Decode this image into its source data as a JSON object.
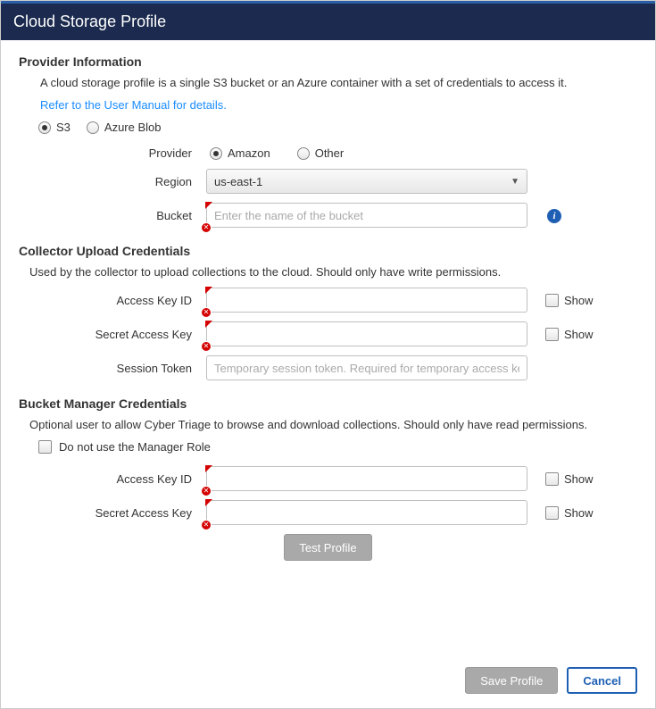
{
  "title": "Cloud Storage Profile",
  "provider_info": {
    "heading": "Provider Information",
    "description": "A cloud storage profile is a single S3 bucket or an Azure container with a set of credentials to access it.",
    "manual_link": "Refer to the User Manual for details.",
    "storage_types": {
      "s3": "S3",
      "azure": "Azure Blob"
    },
    "provider_label": "Provider",
    "providers": {
      "amazon": "Amazon",
      "other": "Other"
    },
    "region_label": "Region",
    "region_value": "us-east-1",
    "bucket_label": "Bucket",
    "bucket_placeholder": "Enter the name of the bucket"
  },
  "collector": {
    "heading": "Collector Upload Credentials",
    "description": "Used by the collector to upload collections to the cloud. Should only have write permissions.",
    "access_key_label": "Access Key ID",
    "secret_key_label": "Secret Access Key",
    "session_token_label": "Session Token",
    "session_token_placeholder": "Temporary session token. Required for temporary access key.",
    "show_label": "Show"
  },
  "manager": {
    "heading": "Bucket Manager Credentials",
    "description": "Optional user to allow Cyber Triage to browse and download collections. Should only have read permissions.",
    "skip_label": "Do not use the Manager Role",
    "access_key_label": "Access Key ID",
    "secret_key_label": "Secret Access Key",
    "show_label": "Show"
  },
  "buttons": {
    "test": "Test Profile",
    "save": "Save Profile",
    "cancel": "Cancel"
  }
}
